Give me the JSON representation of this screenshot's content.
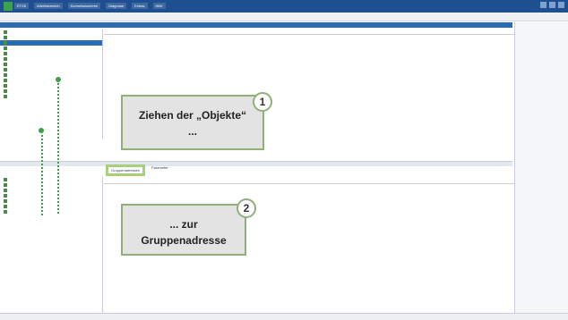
{
  "app": {
    "menu": [
      "ETS5",
      "Arbeitsbereich",
      "Kommissionieren",
      "Diagnose",
      "Extras",
      "Hilfe"
    ]
  },
  "callout1": {
    "number": "1",
    "line1": "Ziehen der „Objekte“",
    "line2": "..."
  },
  "callout2": {
    "number": "2",
    "line1": "... zur",
    "line2": "Gruppenadresse"
  },
  "bottom_tabs": {
    "active": "Gruppenadressen",
    "other": "Parameter"
  },
  "colors": {
    "accent": "#2b6cb6",
    "callout_border": "#8fb07a",
    "arrow": "#3aa34a"
  }
}
